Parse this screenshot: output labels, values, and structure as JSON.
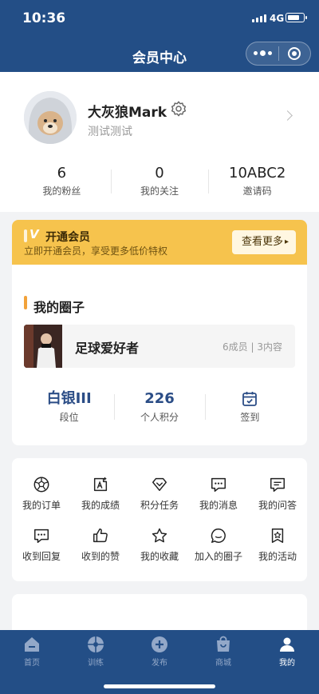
{
  "status_bar": {
    "time": "10:36",
    "network": "4G"
  },
  "nav": {
    "title": "会员中心"
  },
  "profile": {
    "name": "大灰狼Mark",
    "subtitle": "测试测试",
    "stats": [
      {
        "value": "6",
        "label": "我的粉丝"
      },
      {
        "value": "0",
        "label": "我的关注"
      },
      {
        "value": "10ABC2",
        "label": "邀请码"
      }
    ]
  },
  "vip": {
    "badge": "V",
    "title": "开通会员",
    "subtitle": "立即开通会员，享受更多低价特权",
    "button": "查看更多"
  },
  "circle": {
    "section_title": "我的圈子",
    "group": {
      "name": "足球爱好者",
      "meta": "6成员 | 3内容"
    },
    "stats": [
      {
        "value": "白银III",
        "label": "段位"
      },
      {
        "value": "226",
        "label": "个人积分"
      },
      {
        "label": "签到"
      }
    ]
  },
  "menu": [
    {
      "label": "我的订单",
      "icon": "soccer-ball-icon"
    },
    {
      "label": "我的成绩",
      "icon": "score-icon"
    },
    {
      "label": "积分任务",
      "icon": "diamond-icon"
    },
    {
      "label": "我的消息",
      "icon": "message-icon"
    },
    {
      "label": "我的问答",
      "icon": "qa-icon"
    },
    {
      "label": "收到回复",
      "icon": "reply-icon"
    },
    {
      "label": "收到的赞",
      "icon": "thumbs-up-icon"
    },
    {
      "label": "我的收藏",
      "icon": "star-icon"
    },
    {
      "label": "加入的圈子",
      "icon": "circle-chat-icon"
    },
    {
      "label": "我的活动",
      "icon": "activity-icon"
    }
  ],
  "tabbar": {
    "active": "我的",
    "tabs": [
      {
        "label": "首页",
        "icon": "home-icon"
      },
      {
        "label": "训练",
        "icon": "training-icon"
      },
      {
        "label": "发布",
        "icon": "publish-icon"
      },
      {
        "label": "商城",
        "icon": "shop-icon"
      },
      {
        "label": "我的",
        "icon": "profile-icon"
      }
    ]
  },
  "colors": {
    "primary": "#234e86",
    "vip": "#f6c34d",
    "accent": "#f2a23a",
    "stat_value": "#2b4d86"
  }
}
